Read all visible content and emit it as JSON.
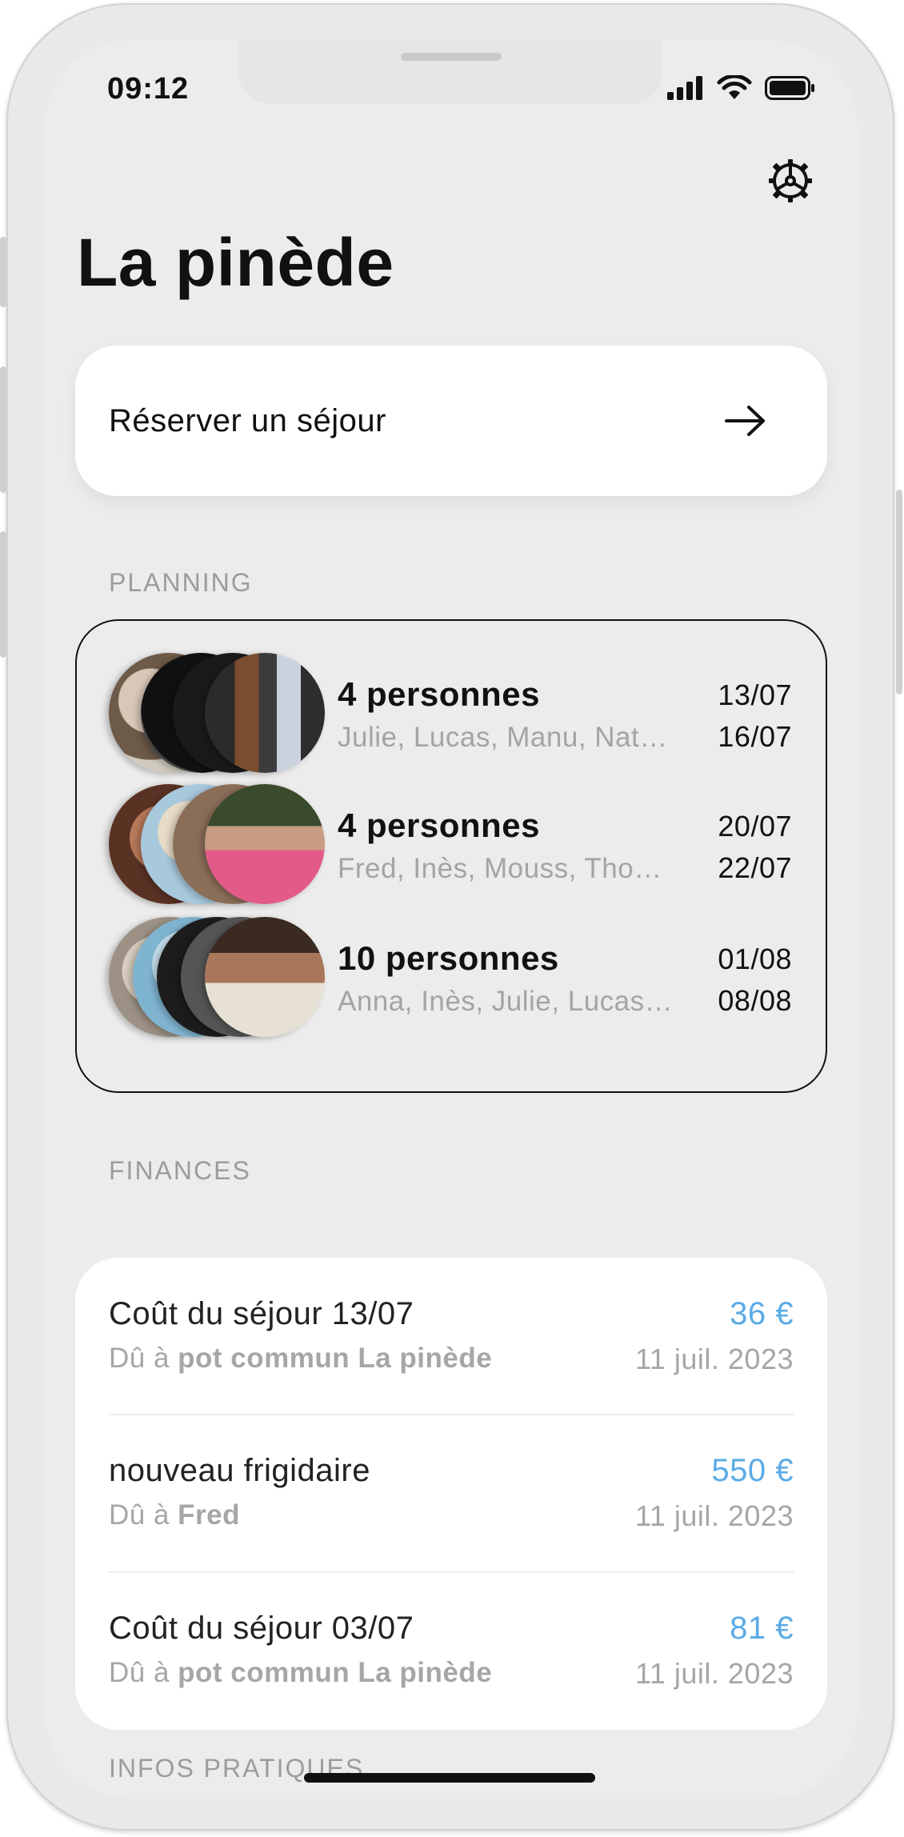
{
  "status_bar": {
    "time": "09:12"
  },
  "header": {
    "title": "La pinède",
    "settings_icon": "gear-icon"
  },
  "reserve": {
    "label": "Réserver un séjour",
    "icon": "arrow-right-icon"
  },
  "planning": {
    "section_label": "PLANNING",
    "stays": [
      {
        "count": "4 personnes",
        "names": "Julie, Lucas, Manu, Nat…",
        "start": "13/07",
        "end": "16/07"
      },
      {
        "count": "4 personnes",
        "names": "Fred, Inès, Mouss, Tho…",
        "start": "20/07",
        "end": "22/07"
      },
      {
        "count": "10 personnes",
        "names": "Anna, Inès, Julie, Lucas…",
        "start": "01/08",
        "end": "08/08"
      }
    ]
  },
  "finances": {
    "section_label": "FINANCES",
    "items": [
      {
        "title": "Coût du séjour 13/07",
        "prefix": "Dû à ",
        "payee": "pot commun La pinède",
        "amount": "36 €",
        "date": "11 juil. 2023"
      },
      {
        "title": "nouveau frigidaire",
        "prefix": "Dû à ",
        "payee": "Fred",
        "amount": "550 €",
        "date": "11 juil. 2023"
      },
      {
        "title": "Coût du séjour 03/07",
        "prefix": "Dû à ",
        "payee": "pot commun La pinède",
        "amount": "81 €",
        "date": "11 juil. 2023"
      }
    ]
  },
  "infos": {
    "section_label": "INFOS PRATIQUES"
  },
  "colors": {
    "amount": "#5aabe6",
    "muted": "#a6a6a6",
    "screen_bg": "#ececec"
  }
}
